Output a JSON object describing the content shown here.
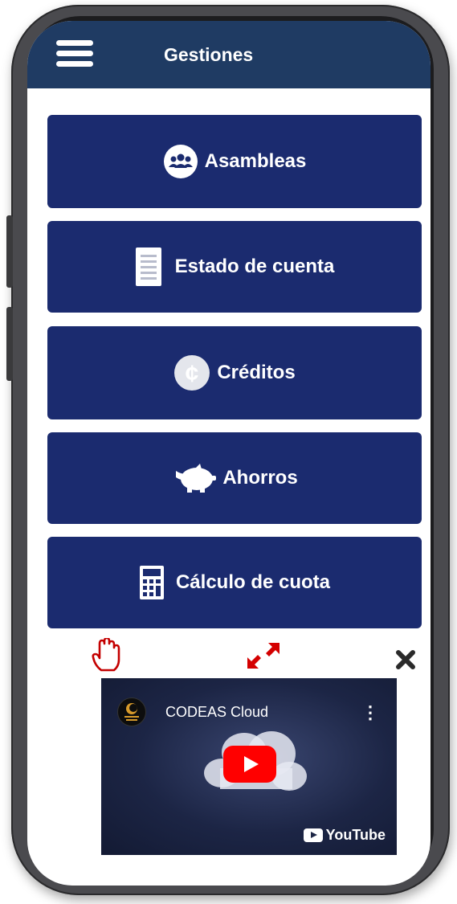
{
  "app_bar": {
    "title": "Gestiones",
    "background": "#1f3b63"
  },
  "menu": [
    {
      "label": "Asambleas",
      "icon": "people-group-icon"
    },
    {
      "label": "Estado de cuenta",
      "icon": "document-icon"
    },
    {
      "label": "Créditos",
      "icon": "colon-currency-icon"
    },
    {
      "label": "Ahorros",
      "icon": "piggy-bank-icon"
    },
    {
      "label": "Cálculo de cuota",
      "icon": "calculator-icon"
    }
  ],
  "button_color": "#1b2b6f",
  "floating_controls": {
    "drag": "hand-drag-icon",
    "expand": "expand-arrows-icon",
    "close": "close-icon",
    "accent": "#cc0000"
  },
  "video": {
    "title": "CODEAS Cloud",
    "logo_text": "YouTube"
  }
}
